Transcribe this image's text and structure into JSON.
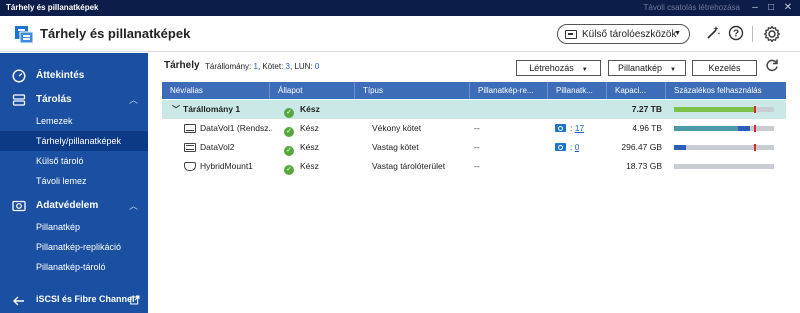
{
  "window": {
    "title": "Tárhely és pillanatképek",
    "remote_text": "Távoli csatolás létrehozása"
  },
  "header": {
    "app_title": "Tárhely és pillanatképek",
    "external_storage_button": "Külső tárolóeszközök"
  },
  "sidebar": {
    "sections": [
      {
        "label": "Áttekintés"
      },
      {
        "label": "Tárolás",
        "items": [
          "Lemezek",
          "Tárhely/pillanatképek",
          "Külső tároló",
          "Távoli lemez"
        ]
      },
      {
        "label": "Adatvédelem",
        "items": [
          "Pillanatkép",
          "Pillanatkép-replikáció",
          "Pillanatkép-tároló"
        ]
      }
    ],
    "bottom_label": "iSCSI és Fibre Channel",
    "active_item": "Tárhely/pillanatképek"
  },
  "main": {
    "title": "Tárhely",
    "meta_pool_label": "Tárállomány:",
    "meta_pool": "1",
    "meta_vol_label": "Kötet:",
    "meta_vol": "3",
    "meta_lun_label": "LUN:",
    "meta_lun": "0",
    "buttons": {
      "create": "Létrehozás",
      "snapshot": "Pillanatkép",
      "manage": "Kezelés"
    },
    "columns": [
      "Név/alias",
      "Állapot",
      "Típus",
      "Pillanatkép-re...",
      "Pillanatk...",
      "Kapaci...",
      "Százalékos felhasználás"
    ],
    "rows": [
      {
        "name": "Tárállomány 1",
        "status": "Kész",
        "type": "",
        "sched": "",
        "snaps": "",
        "capacity": "7.27 TB",
        "usage": {
          "used": 0.4,
          "used2": 0.4,
          "threshold": 0.8
        }
      },
      {
        "name": "DataVol1 (Rendsz...",
        "status": "Kész",
        "type": "Vékony kötet",
        "sched": "--",
        "snaps": "17",
        "capacity": "4.96 TB",
        "usage": {
          "used": 0.64,
          "used2": 0.12,
          "threshold": 0.8
        }
      },
      {
        "name": "DataVol2",
        "status": "Kész",
        "type": "Vastag kötet",
        "sched": "--",
        "snaps": "0",
        "capacity": "296.47 GB",
        "usage": {
          "used": 0.12,
          "used2": 0.0,
          "threshold": 0.8
        }
      },
      {
        "name": "HybridMount1",
        "status": "Kész",
        "type": "Vastag tárolóterület",
        "sched": "--",
        "snaps": "",
        "capacity": "18.73 GB",
        "usage": {
          "used": 0.0,
          "used2": 0.0,
          "threshold": null
        }
      }
    ]
  },
  "colors": {
    "sidebar": "#1a4fa1",
    "header_row": "#3d6cb9",
    "pool_row": "#c9e8e6",
    "ok_green": "#56a83e",
    "bar_green": "#7cc24a",
    "bar_teal": "#4d9aa8",
    "bar_blue": "#2c5db8",
    "threshold_red": "#e0262b"
  }
}
